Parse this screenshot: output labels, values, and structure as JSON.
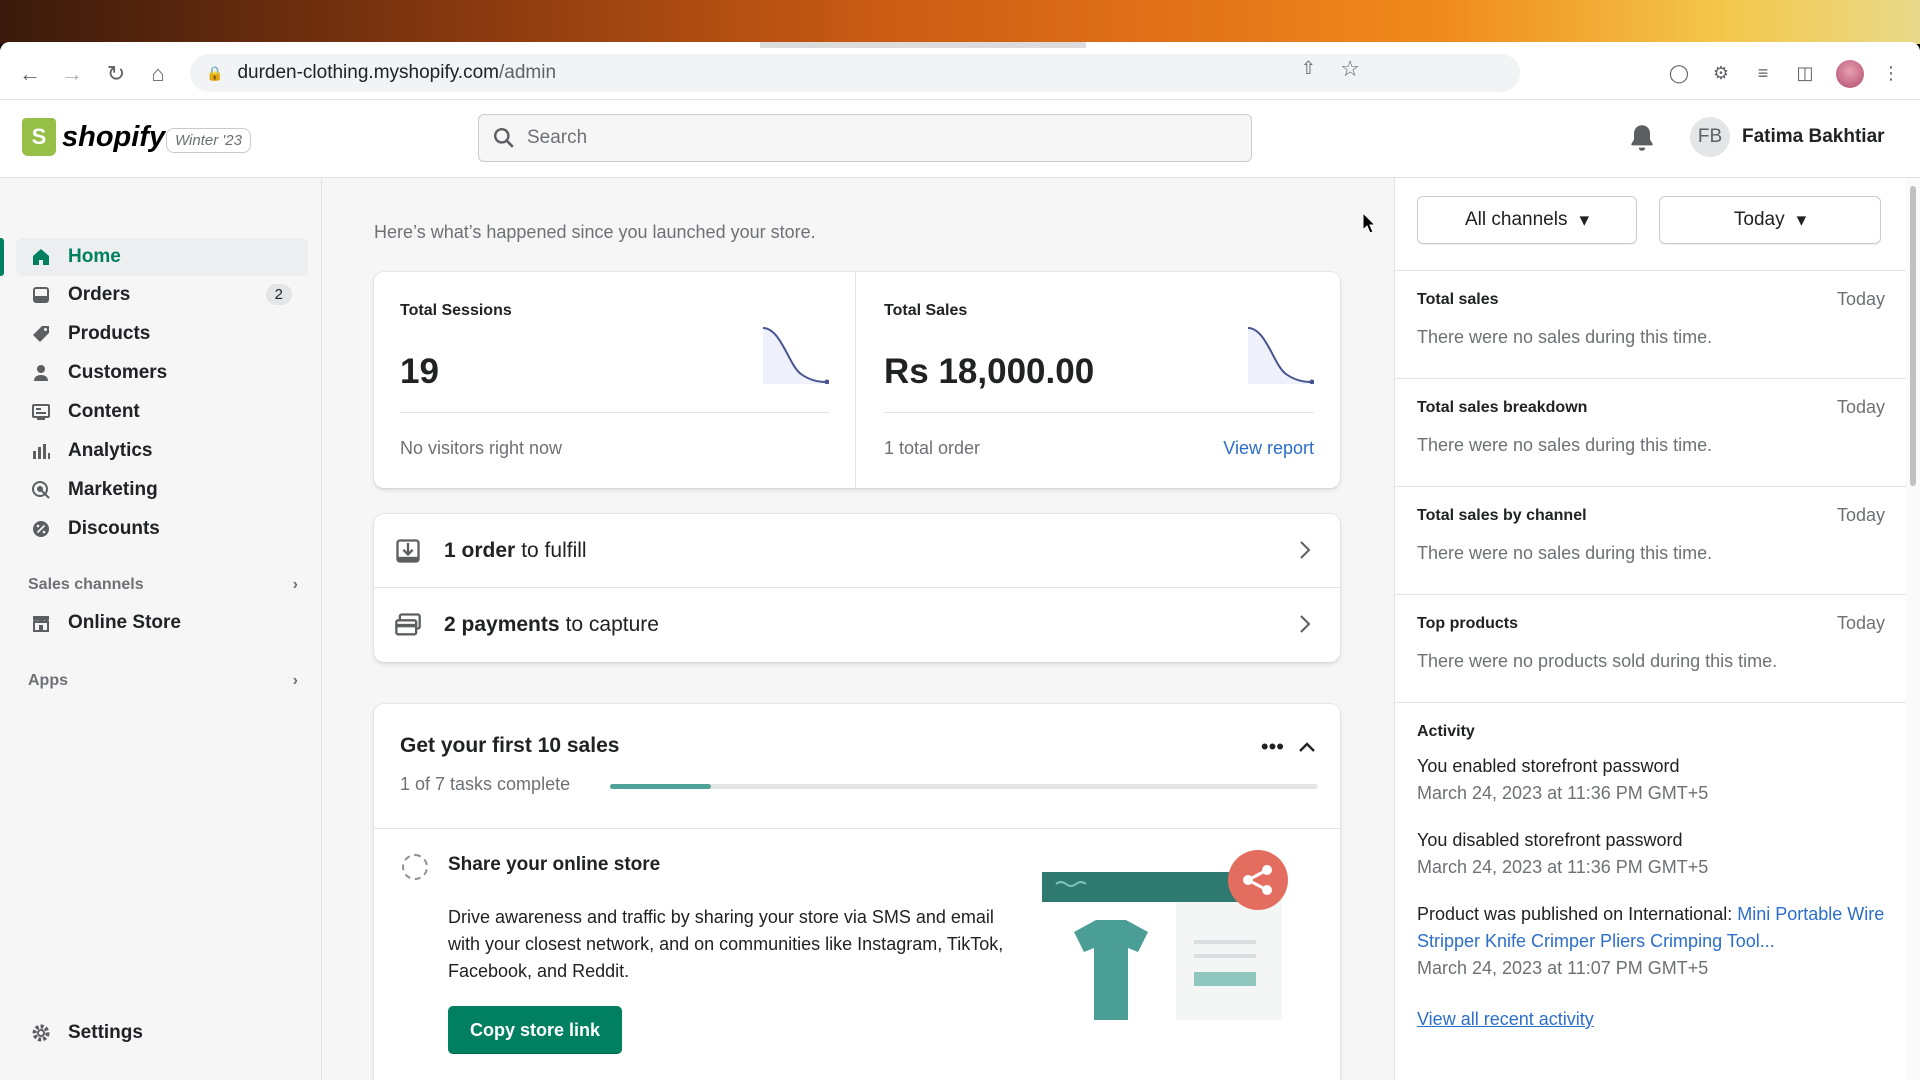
{
  "browser": {
    "url_host": "durden-clothing.myshopify.com",
    "url_path": "/admin"
  },
  "header": {
    "logo_text": "shopify",
    "edition_badge": "Winter '23",
    "search_placeholder": "Search",
    "user_initials": "FB",
    "user_name": "Fatima Bakhtiar"
  },
  "sidebar": {
    "items": [
      {
        "label": "Home",
        "icon": "home-icon",
        "active": true
      },
      {
        "label": "Orders",
        "icon": "orders-icon",
        "badge": "2"
      },
      {
        "label": "Products",
        "icon": "tag-icon"
      },
      {
        "label": "Customers",
        "icon": "person-icon"
      },
      {
        "label": "Content",
        "icon": "content-icon"
      },
      {
        "label": "Analytics",
        "icon": "bar-chart-icon"
      },
      {
        "label": "Marketing",
        "icon": "target-icon"
      },
      {
        "label": "Discounts",
        "icon": "discount-icon"
      }
    ],
    "sales_channels_heading": "Sales channels",
    "online_store": "Online Store",
    "apps_heading": "Apps",
    "settings": "Settings"
  },
  "main": {
    "intro": "Here’s what’s happened since you launched your store.",
    "sessions": {
      "label": "Total Sessions",
      "value": "19",
      "footer": "No visitors right now"
    },
    "sales": {
      "label": "Total Sales",
      "value": "Rs 18,000.00",
      "footer": "1 total order",
      "link": "View report"
    },
    "tasks": [
      {
        "bold": "1 order",
        "rest": "to fulfill"
      },
      {
        "bold": "2 payments",
        "rest": "to capture"
      }
    ],
    "guide": {
      "title": "Get your first 10 sales",
      "progress_text": "1 of 7 tasks complete",
      "progress_fraction": 0.143,
      "step_title": "Share your online store",
      "step_desc": "Drive awareness and traffic by sharing your store via SMS and email with your closest network, and on communities like Instagram, TikTok, Facebook, and Reddit.",
      "button": "Copy store link"
    }
  },
  "right_panel": {
    "channel_filter": "All channels",
    "date_filter": "Today",
    "sections": [
      {
        "heading": "Total sales",
        "date": "Today",
        "text": "There were no sales during this time."
      },
      {
        "heading": "Total sales breakdown",
        "date": "Today",
        "text": "There were no sales during this time."
      },
      {
        "heading": "Total sales by channel",
        "date": "Today",
        "text": "There were no sales during this time."
      },
      {
        "heading": "Top products",
        "date": "Today",
        "text": "There were no products sold during this time."
      }
    ],
    "activity_heading": "Activity",
    "activity": [
      {
        "text": "You enabled storefront password",
        "time": "March 24, 2023 at 11:36 PM GMT+5"
      },
      {
        "text": "You disabled storefront password",
        "time": "March 24, 2023 at 11:36 PM GMT+5"
      },
      {
        "text": "Product was published on International: ",
        "link": "Mini Portable Wire Stripper Knife Crimper Pliers Crimping Tool...",
        "time": "March 24, 2023 at 11:07 PM GMT+5"
      }
    ],
    "view_all": "View all recent activity"
  },
  "colors": {
    "accent": "#008060",
    "link": "#2c6ecb",
    "brand": "#95bf47"
  }
}
